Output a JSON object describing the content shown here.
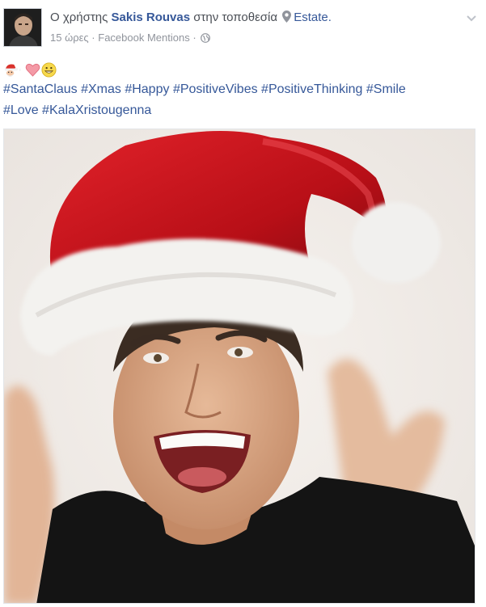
{
  "post": {
    "prefix": "Ο χρήστης",
    "author": "Sakis Rouvas",
    "location_prefix": "στην τοποθεσία",
    "location": "Estate.",
    "time": "15 ώρες",
    "separator": " · ",
    "source": "Facebook Mentions",
    "audience_icon": "globe-icon",
    "menu_icon": "chevron-down-icon",
    "emojis": [
      "santa-emoji",
      "heart-emoji",
      "grinning-emoji"
    ],
    "hashtags": [
      "#SantaClaus",
      "#Xmas",
      "#Happy",
      "#PositiveVibes",
      "#PositiveThinking",
      "#Smile",
      "#Love",
      "#KalaXristougenna"
    ]
  },
  "colors": {
    "link": "#365899",
    "meta": "#90949c",
    "text": "#4b4f56",
    "hat_red": "#c8141c",
    "fur_white": "#f4f4f2"
  }
}
